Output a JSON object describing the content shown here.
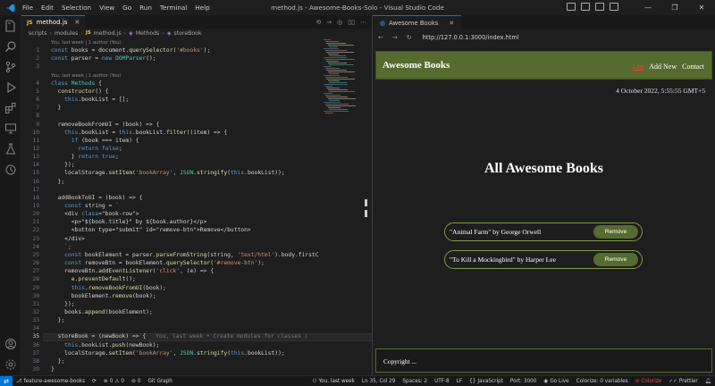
{
  "window": {
    "title": "method.js - Awesome-Books-Solo - Visual Studio Code",
    "menu": [
      "File",
      "Edit",
      "Selection",
      "View",
      "Go",
      "Run",
      "Terminal",
      "Help"
    ]
  },
  "editor": {
    "tab": {
      "label": "method.js",
      "lang_badge": "JS"
    },
    "breadcrumb": {
      "folders": [
        "scripts",
        "modules"
      ],
      "file": "method.js",
      "class": "Methods",
      "member": "storeBook"
    },
    "blame_top": "You, last week | 1 author (You)",
    "blame_class": "You, last week | 1 author (You)",
    "current_line": 35,
    "inline_blame": "You, last week • Create modules for classes |",
    "lines": [
      {
        "n": 1,
        "text": "const books = document.querySelector('#books');"
      },
      {
        "n": 2,
        "text": "const parser = new DOMParser();"
      },
      {
        "n": 3,
        "text": ""
      },
      {
        "n": 4,
        "text": "class Methods {"
      },
      {
        "n": 5,
        "text": "  constructor() {"
      },
      {
        "n": 6,
        "text": "    this.bookList = [];"
      },
      {
        "n": 7,
        "text": "  }"
      },
      {
        "n": 8,
        "text": ""
      },
      {
        "n": 9,
        "text": "  removeBookFromUI = (book) => {"
      },
      {
        "n": 10,
        "text": "    this.bookList = this.bookList.filter((item) => {"
      },
      {
        "n": 11,
        "text": "      if (book === item) {"
      },
      {
        "n": 12,
        "text": "        return false;"
      },
      {
        "n": 13,
        "text": "      } return true;"
      },
      {
        "n": 14,
        "text": "    });"
      },
      {
        "n": 15,
        "text": "    localStorage.setItem('bookArray', JSON.stringify(this.bookList));"
      },
      {
        "n": 16,
        "text": "  };"
      },
      {
        "n": 17,
        "text": ""
      },
      {
        "n": 18,
        "text": "  addBookToUI = (book) => {"
      },
      {
        "n": 19,
        "text": "    const string = `"
      },
      {
        "n": 20,
        "text": "    <div class=\"book-row\">"
      },
      {
        "n": 21,
        "text": "      <p>\"${book.title}\" by ${book.author}</p>"
      },
      {
        "n": 22,
        "text": "      <button type=\"submit\" id=\"remove-btn\">Remove</button>"
      },
      {
        "n": 23,
        "text": "    </div>"
      },
      {
        "n": 24,
        "text": "    `;"
      },
      {
        "n": 25,
        "text": "    const bookElement = parser.parseFromString(string, 'text/html').body.firstC"
      },
      {
        "n": 26,
        "text": "    const removeBtn = bookElement.querySelector('#remove-btn');"
      },
      {
        "n": 27,
        "text": "    removeBtn.addEventListener('click', (e) => {"
      },
      {
        "n": 28,
        "text": "      e.preventDefault();"
      },
      {
        "n": 29,
        "text": "      this.removeBookFromUI(book);"
      },
      {
        "n": 30,
        "text": "      bookElement.remove(book);"
      },
      {
        "n": 31,
        "text": "    });"
      },
      {
        "n": 32,
        "text": "    books.append(bookElement);"
      },
      {
        "n": 33,
        "text": "  };"
      },
      {
        "n": 34,
        "text": ""
      },
      {
        "n": 35,
        "text": "  storeBook = (newBook) => {"
      },
      {
        "n": 36,
        "text": "    this.bookList.push(newBook);"
      },
      {
        "n": 37,
        "text": "    localStorage.setItem('bookArray', JSON.stringify(this.bookList));"
      },
      {
        "n": 38,
        "text": "  };"
      },
      {
        "n": 39,
        "text": "}"
      }
    ]
  },
  "browser": {
    "tab_label": "Awesome Books",
    "url": "http://127.0.0.1:3000/index.html",
    "page": {
      "brand": "Awesome Books",
      "nav": {
        "list": "List",
        "add": "Add New",
        "contact": "Contact"
      },
      "datetime": "4 October 2022, 5:55:55 GMT+5",
      "heading": "All Awesome Books",
      "books": [
        {
          "text": "\"Animal Farm\" by George Orwell",
          "button": "Remove"
        },
        {
          "text": "\"To Kill a Mockingbird\" by Harper Lee",
          "button": "Remove"
        }
      ],
      "footer": "Copyright ..."
    }
  },
  "statusbar": {
    "branch": "feature-awesome-books",
    "errors": "0",
    "warnings": "0",
    "ports": "0",
    "git_graph": "Git Graph",
    "blame": "You, last week",
    "position": "Ln 35, Col 29",
    "spaces": "Spaces: 2",
    "encoding": "UTF-8",
    "eol": "LF",
    "language": "JavaScript",
    "port": "Port: 3000",
    "go_live": "Go Live",
    "colorize_vars": "Colorize: 0 variables",
    "colorize": "Colorize",
    "prettier": "Prettier"
  },
  "colors": {
    "accent": "#0078d4",
    "navbar": "#556b2f",
    "active_link": "#ff3b30"
  }
}
